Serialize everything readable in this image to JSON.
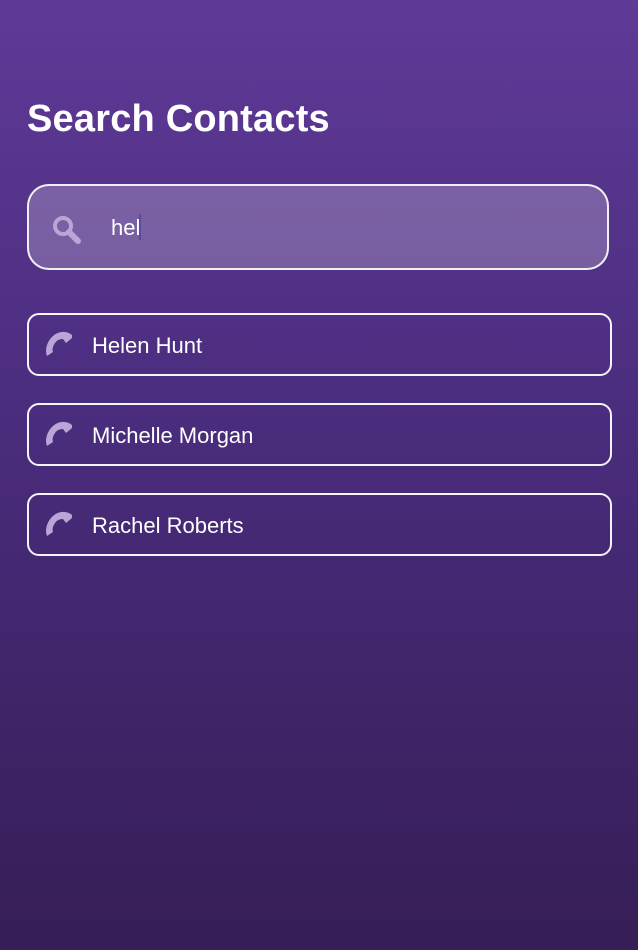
{
  "header": {
    "title": "Search Contacts"
  },
  "search": {
    "value": "hel",
    "icon": "search-icon"
  },
  "contacts": [
    {
      "name": "Helen Hunt",
      "icon": "phone-icon"
    },
    {
      "name": "Michelle Morgan",
      "icon": "phone-icon"
    },
    {
      "name": "Rachel Roberts",
      "icon": "phone-icon"
    }
  ],
  "colors": {
    "background_top": "#5f3a97",
    "background_bottom": "#361e56",
    "icon": "#b9a6d6",
    "text": "#ffffff"
  }
}
